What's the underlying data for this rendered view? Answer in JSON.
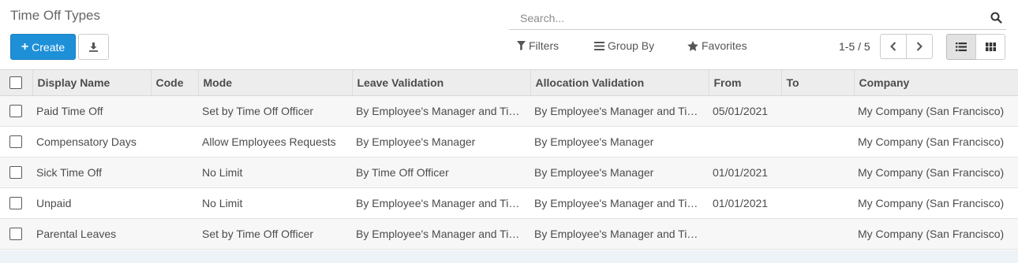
{
  "page": {
    "title": "Time Off Types"
  },
  "toolbar": {
    "create_label": "Create",
    "export_icon": "download-icon"
  },
  "search": {
    "placeholder": "Search...",
    "icon": "search-icon"
  },
  "filters": {
    "filters_label": "Filters",
    "group_by_label": "Group By",
    "favorites_label": "Favorites"
  },
  "pager": {
    "range": "1-5 / 5"
  },
  "views": {
    "active": "list",
    "items": [
      "list",
      "kanban"
    ]
  },
  "colors": {
    "primary": "#1e90d8",
    "header_bg": "#ededed"
  },
  "table": {
    "columns": [
      "Display Name",
      "Code",
      "Mode",
      "Leave Validation",
      "Allocation Validation",
      "From",
      "To",
      "Company"
    ],
    "rows": [
      {
        "name": "Paid Time Off",
        "code": "",
        "mode": "Set by Time Off Officer",
        "leave": "By Employee's Manager and Time Off Officer",
        "alloc": "By Employee's Manager and Time Off Officer",
        "from": "05/01/2021",
        "to": "",
        "company": "My Company (San Francisco)"
      },
      {
        "name": "Compensatory Days",
        "code": "",
        "mode": "Allow Employees Requests",
        "leave": "By Employee's Manager",
        "alloc": "By Employee's Manager",
        "from": "",
        "to": "",
        "company": "My Company (San Francisco)"
      },
      {
        "name": "Sick Time Off",
        "code": "",
        "mode": "No Limit",
        "leave": "By Time Off Officer",
        "alloc": "By Employee's Manager",
        "from": "01/01/2021",
        "to": "",
        "company": "My Company (San Francisco)"
      },
      {
        "name": "Unpaid",
        "code": "",
        "mode": "No Limit",
        "leave": "By Employee's Manager and Time Off Officer",
        "alloc": "By Employee's Manager and Time Off Officer",
        "from": "01/01/2021",
        "to": "",
        "company": "My Company (San Francisco)"
      },
      {
        "name": "Parental Leaves",
        "code": "",
        "mode": "Set by Time Off Officer",
        "leave": "By Employee's Manager and Time Off Officer",
        "alloc": "By Employee's Manager and Time Off Officer",
        "from": "",
        "to": "",
        "company": "My Company (San Francisco)"
      }
    ]
  }
}
